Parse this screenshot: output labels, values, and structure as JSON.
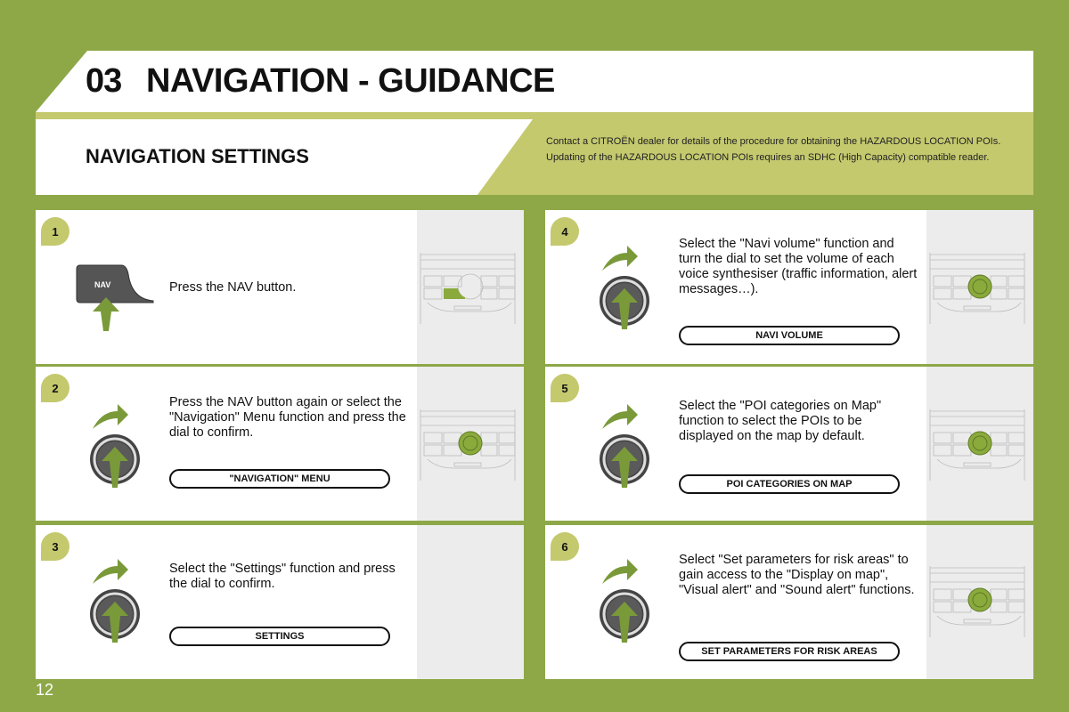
{
  "header": {
    "chapter_number": "03",
    "chapter_title": "NAVIGATION - GUIDANCE",
    "section_title": "NAVIGATION SETTINGS",
    "note": "Contact a CITROËN dealer for details of the procedure for obtaining the HAZARDOUS LOCATION POIs. Updating of the HAZARDOUS LOCATION POIs requires an SDHC (High Capacity) compatible reader."
  },
  "steps": [
    {
      "number": "1",
      "text": "Press the NAV button.",
      "menu_label": null,
      "nav_key_label": "NAV"
    },
    {
      "number": "2",
      "text": "Press the NAV button again or select the \"Navigation\" Menu function and press the dial to confirm.",
      "menu_label": "\"NAVIGATION\" MENU"
    },
    {
      "number": "3",
      "text": "Select the \"Settings\" function and press the dial to confirm.",
      "menu_label": "SETTINGS"
    },
    {
      "number": "4",
      "text": "Select the \"Navi volume\" function and turn the dial to set the volume of each voice synthesiser (traffic information, alert messages…).",
      "menu_label": "NAVI VOLUME"
    },
    {
      "number": "5",
      "text": "Select the \"POI categories on Map\" function to select the POIs to be displayed on the map by default.",
      "menu_label": "POI CATEGORIES ON MAP"
    },
    {
      "number": "6",
      "text": "Select \"Set parameters for risk areas\" to gain access to the \"Display on map\", \"Visual alert\" and \"Sound alert\" functions.",
      "menu_label": "SET PARAMETERS FOR RISK AREAS"
    }
  ],
  "footer": {
    "page_number": "12"
  },
  "colors": {
    "background": "#8ea848",
    "accent_light": "#c4c96e",
    "accent_dark": "#7a9a3a",
    "highlight": "#8aaa3c"
  }
}
